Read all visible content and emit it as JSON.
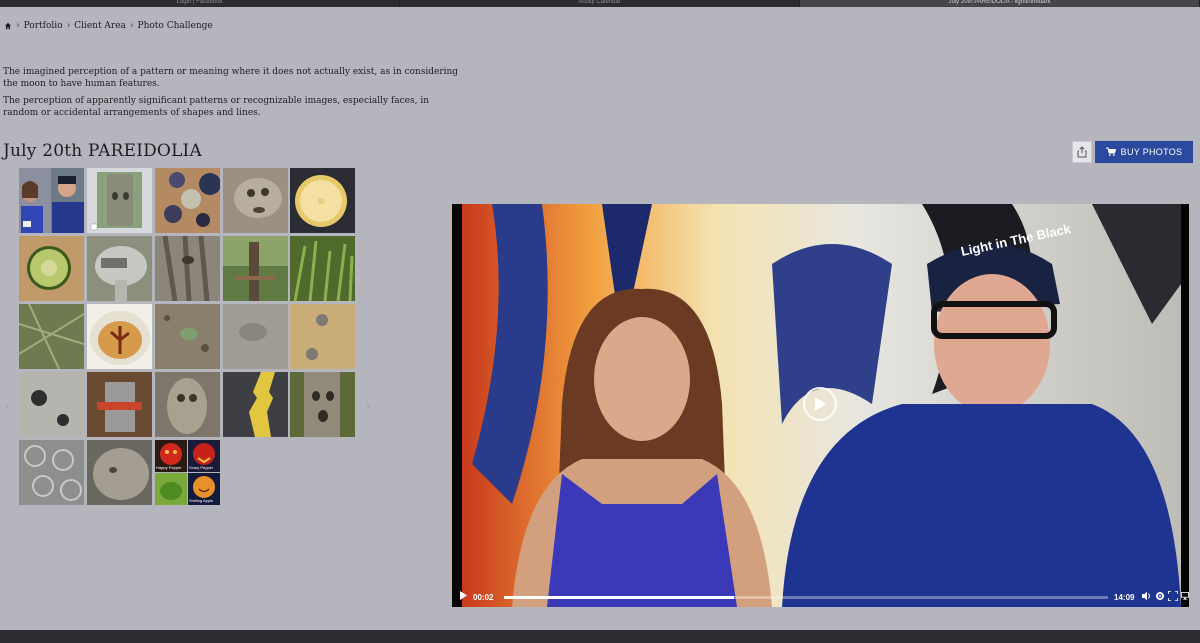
{
  "browser_tabs": [
    {
      "label": "Login | Facebook",
      "active": false
    },
    {
      "label": "Acuity Calendar",
      "active": false
    },
    {
      "label": "July 20th PAREIDOLIA - lightinthedark",
      "active": true
    }
  ],
  "breadcrumb": {
    "home_icon": "home-icon",
    "items": [
      "Portfolio",
      "Client Area",
      "Photo Challenge"
    ],
    "separator": "›"
  },
  "description": [
    "The imagined perception of a pattern or meaning where it does not actually exist, as in considering the moon to have human features.",
    "The perception of apparently significant patterns or recognizable images, especially faces, in random or accidental arrangements of shapes and lines."
  ],
  "gallery": {
    "title": "July 20th PAREIDOLIA",
    "share_icon": "share-icon",
    "buy_label": "BUY PHOTOS",
    "cart_icon": "cart-icon",
    "prev_icon": "chevron-left-icon",
    "next_icon": "chevron-right-icon",
    "collage_texts": [
      "Happy Pepper",
      "Scary Pepper",
      "Smiling Apple"
    ]
  },
  "video": {
    "play_icon": "play-icon",
    "current_time": "00:02",
    "duration": "14:09",
    "progress_fraction": 0.38,
    "cap_text": "Light in The Black",
    "icons": [
      "volume-icon",
      "settings-icon",
      "fullscreen-icon",
      "airplay-icon"
    ]
  },
  "colors": {
    "background": "#b4b5bd",
    "accent": "#2b4a9f"
  }
}
